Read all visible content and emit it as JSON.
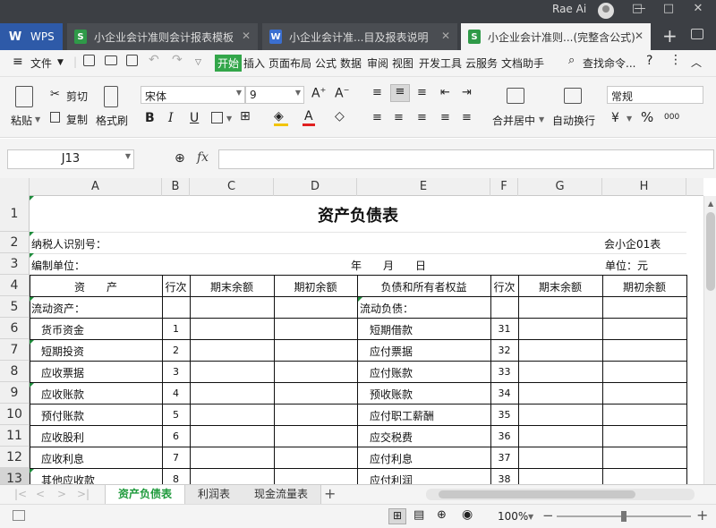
{
  "titlebar": {
    "user": "Rae Ai",
    "tabs": [
      {
        "label": "WPS",
        "icon": "W"
      },
      {
        "label": "小企业会计准则会计报表模板",
        "icon": "S"
      },
      {
        "label": "小企业会计准...目及报表说明",
        "icon": "W"
      },
      {
        "label": "小企业会计准则...(完整含公式)",
        "icon": "S"
      }
    ],
    "add": "+"
  },
  "menu": {
    "file": "文件",
    "items": [
      "开始",
      "插入",
      "页面布局",
      "公式",
      "数据",
      "审阅",
      "视图",
      "开发工具",
      "云服务",
      "文档助手"
    ],
    "search": "查找命令..."
  },
  "ribbon": {
    "paste": "粘贴",
    "cut": "剪切",
    "copy": "复制",
    "format_painter": "格式刷",
    "font": "宋体",
    "size": "9",
    "bold": "B",
    "italic": "I",
    "underline": "U",
    "merge": "合并居中",
    "wrap": "自动换行",
    "number_format": "常规",
    "percent": "%",
    "thousands": "000"
  },
  "formula": {
    "cell_ref": "J13",
    "fx": "fx",
    "value": ""
  },
  "sheet": {
    "columns": [
      "A",
      "B",
      "C",
      "D",
      "E",
      "F",
      "G",
      "H"
    ],
    "rows": [
      "1",
      "2",
      "3",
      "4",
      "5",
      "6",
      "7",
      "8",
      "9",
      "10",
      "11",
      "12",
      "13"
    ],
    "title": "资产负债表",
    "taxpayer": "纳税人识别号：",
    "form_no": "会小企01表",
    "company": "编制单位：",
    "date": "年　　月　　日",
    "unit": "单位：元",
    "headers": [
      "资　　产",
      "行次",
      "期末余额",
      "期初余额",
      "负债和所有者权益",
      "行次",
      "期末余额",
      "期初余额"
    ],
    "left_section": "流动资产：",
    "right_section": "流动负债：",
    "left_items": [
      {
        "name": "货币资金",
        "line": "1"
      },
      {
        "name": "短期投资",
        "line": "2"
      },
      {
        "name": "应收票据",
        "line": "3"
      },
      {
        "name": "应收账款",
        "line": "4"
      },
      {
        "name": "预付账款",
        "line": "5"
      },
      {
        "name": "应收股利",
        "line": "6"
      },
      {
        "name": "应收利息",
        "line": "7"
      },
      {
        "name": "其他应收款",
        "line": "8"
      }
    ],
    "right_items": [
      {
        "name": "短期借款",
        "line": "31"
      },
      {
        "name": "应付票据",
        "line": "32"
      },
      {
        "name": "应付账款",
        "line": "33"
      },
      {
        "name": "预收账款",
        "line": "34"
      },
      {
        "name": "应付职工薪酬",
        "line": "35"
      },
      {
        "name": "应交税费",
        "line": "36"
      },
      {
        "name": "应付利息",
        "line": "37"
      },
      {
        "name": "应付利润",
        "line": "38"
      }
    ]
  },
  "sheet_tabs": [
    "资产负债表",
    "利润表",
    "现金流量表"
  ],
  "status": {
    "zoom": "100%",
    "minus": "−",
    "plus": "+"
  },
  "colors": {
    "accent": "#33a64a",
    "titlebar": "#3c3f44"
  }
}
